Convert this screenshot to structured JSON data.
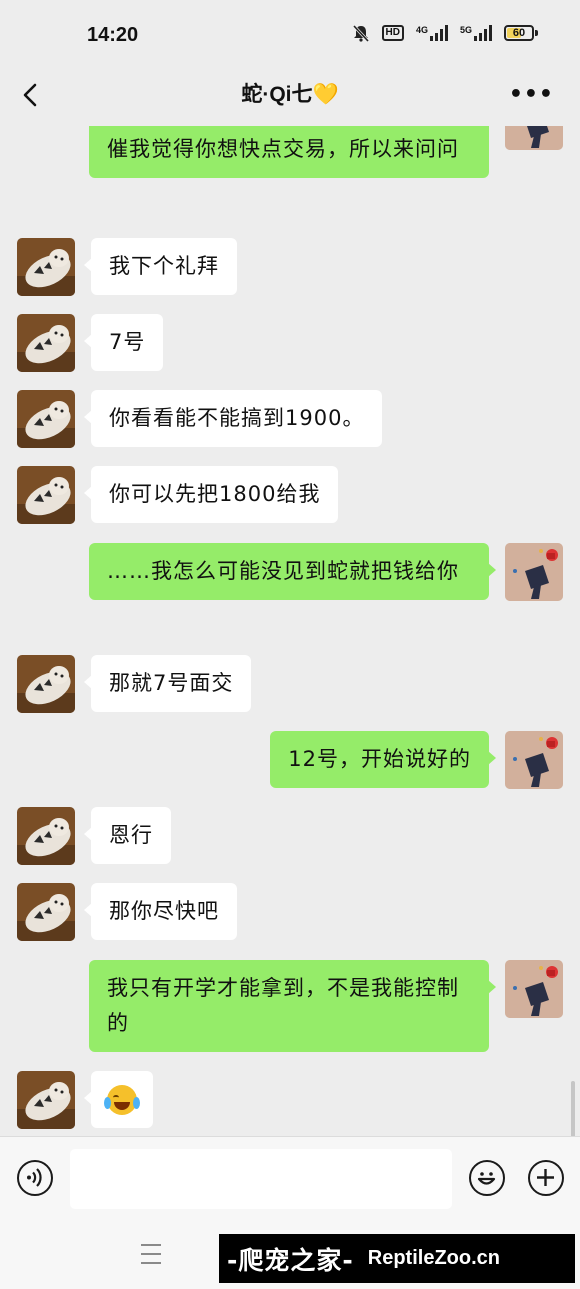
{
  "status_bar": {
    "time": "14:20",
    "hd_label": "HD",
    "network_1": "4G",
    "network_2": "5G",
    "battery": "60",
    "battery_level_percent": 60,
    "icons": [
      "mute-bell-icon",
      "hd-icon",
      "signal-4g-icon",
      "signal-5g-icon",
      "battery-icon"
    ]
  },
  "header": {
    "title": "蛇·Qi七💛",
    "back_icon": "chevron-left-icon",
    "more_label": "•••"
  },
  "messages": [
    {
      "side": "right",
      "text": "我也说了，不着急……只是看你之前催我觉得你想快点交易，所以来问问",
      "partially_visible": true
    },
    {
      "side": "left",
      "text": "我下个礼拜"
    },
    {
      "side": "left",
      "text": "7号"
    },
    {
      "side": "left",
      "text": "你看看能不能搞到1900。"
    },
    {
      "side": "left",
      "text": "你可以先把1800给我"
    },
    {
      "side": "right",
      "text": "……我怎么可能没见到蛇就把钱给你"
    },
    {
      "side": "left",
      "text": "那就7号面交"
    },
    {
      "side": "right",
      "text": "12号，开始说好的"
    },
    {
      "side": "left",
      "text": "恩行"
    },
    {
      "side": "left",
      "text": "那你尽快吧"
    },
    {
      "side": "right",
      "text": "我只有开学才能拿到，不是我能控制的"
    },
    {
      "side": "left",
      "emoji": "crying-laughing-emoji"
    }
  ],
  "input_bar": {
    "voice_icon": "voice-icon",
    "emoji_icon": "emoji-icon",
    "plus_icon": "plus-icon"
  },
  "bottom_nav": {
    "menu_icon": "menu-icon"
  },
  "watermark": {
    "cn_text": "-爬宠之家-",
    "en_text": "ReptileZoo.cn"
  }
}
